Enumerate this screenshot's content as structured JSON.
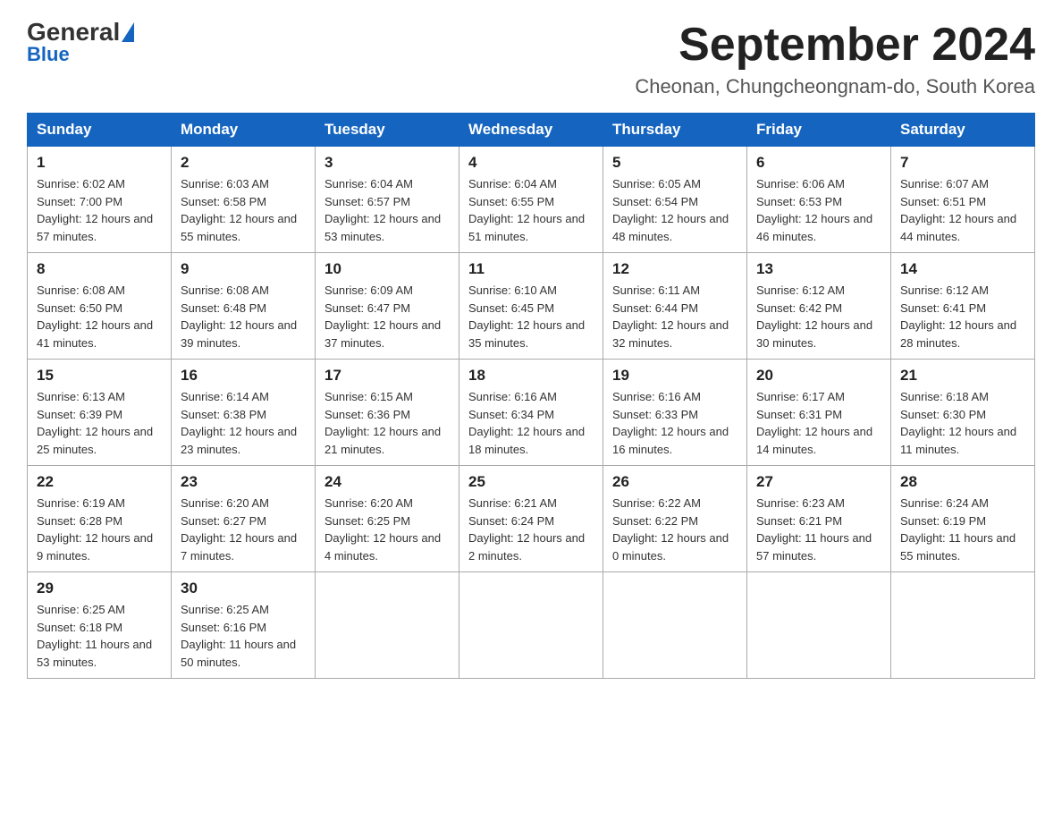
{
  "header": {
    "logo_general": "General",
    "logo_blue": "Blue",
    "month_title": "September 2024",
    "location": "Cheonan, Chungcheongnam-do, South Korea"
  },
  "weekdays": [
    "Sunday",
    "Monday",
    "Tuesday",
    "Wednesday",
    "Thursday",
    "Friday",
    "Saturday"
  ],
  "weeks": [
    [
      {
        "day": "1",
        "sunrise": "6:02 AM",
        "sunset": "7:00 PM",
        "daylight": "12 hours and 57 minutes."
      },
      {
        "day": "2",
        "sunrise": "6:03 AM",
        "sunset": "6:58 PM",
        "daylight": "12 hours and 55 minutes."
      },
      {
        "day": "3",
        "sunrise": "6:04 AM",
        "sunset": "6:57 PM",
        "daylight": "12 hours and 53 minutes."
      },
      {
        "day": "4",
        "sunrise": "6:04 AM",
        "sunset": "6:55 PM",
        "daylight": "12 hours and 51 minutes."
      },
      {
        "day": "5",
        "sunrise": "6:05 AM",
        "sunset": "6:54 PM",
        "daylight": "12 hours and 48 minutes."
      },
      {
        "day": "6",
        "sunrise": "6:06 AM",
        "sunset": "6:53 PM",
        "daylight": "12 hours and 46 minutes."
      },
      {
        "day": "7",
        "sunrise": "6:07 AM",
        "sunset": "6:51 PM",
        "daylight": "12 hours and 44 minutes."
      }
    ],
    [
      {
        "day": "8",
        "sunrise": "6:08 AM",
        "sunset": "6:50 PM",
        "daylight": "12 hours and 41 minutes."
      },
      {
        "day": "9",
        "sunrise": "6:08 AM",
        "sunset": "6:48 PM",
        "daylight": "12 hours and 39 minutes."
      },
      {
        "day": "10",
        "sunrise": "6:09 AM",
        "sunset": "6:47 PM",
        "daylight": "12 hours and 37 minutes."
      },
      {
        "day": "11",
        "sunrise": "6:10 AM",
        "sunset": "6:45 PM",
        "daylight": "12 hours and 35 minutes."
      },
      {
        "day": "12",
        "sunrise": "6:11 AM",
        "sunset": "6:44 PM",
        "daylight": "12 hours and 32 minutes."
      },
      {
        "day": "13",
        "sunrise": "6:12 AM",
        "sunset": "6:42 PM",
        "daylight": "12 hours and 30 minutes."
      },
      {
        "day": "14",
        "sunrise": "6:12 AM",
        "sunset": "6:41 PM",
        "daylight": "12 hours and 28 minutes."
      }
    ],
    [
      {
        "day": "15",
        "sunrise": "6:13 AM",
        "sunset": "6:39 PM",
        "daylight": "12 hours and 25 minutes."
      },
      {
        "day": "16",
        "sunrise": "6:14 AM",
        "sunset": "6:38 PM",
        "daylight": "12 hours and 23 minutes."
      },
      {
        "day": "17",
        "sunrise": "6:15 AM",
        "sunset": "6:36 PM",
        "daylight": "12 hours and 21 minutes."
      },
      {
        "day": "18",
        "sunrise": "6:16 AM",
        "sunset": "6:34 PM",
        "daylight": "12 hours and 18 minutes."
      },
      {
        "day": "19",
        "sunrise": "6:16 AM",
        "sunset": "6:33 PM",
        "daylight": "12 hours and 16 minutes."
      },
      {
        "day": "20",
        "sunrise": "6:17 AM",
        "sunset": "6:31 PM",
        "daylight": "12 hours and 14 minutes."
      },
      {
        "day": "21",
        "sunrise": "6:18 AM",
        "sunset": "6:30 PM",
        "daylight": "12 hours and 11 minutes."
      }
    ],
    [
      {
        "day": "22",
        "sunrise": "6:19 AM",
        "sunset": "6:28 PM",
        "daylight": "12 hours and 9 minutes."
      },
      {
        "day": "23",
        "sunrise": "6:20 AM",
        "sunset": "6:27 PM",
        "daylight": "12 hours and 7 minutes."
      },
      {
        "day": "24",
        "sunrise": "6:20 AM",
        "sunset": "6:25 PM",
        "daylight": "12 hours and 4 minutes."
      },
      {
        "day": "25",
        "sunrise": "6:21 AM",
        "sunset": "6:24 PM",
        "daylight": "12 hours and 2 minutes."
      },
      {
        "day": "26",
        "sunrise": "6:22 AM",
        "sunset": "6:22 PM",
        "daylight": "12 hours and 0 minutes."
      },
      {
        "day": "27",
        "sunrise": "6:23 AM",
        "sunset": "6:21 PM",
        "daylight": "11 hours and 57 minutes."
      },
      {
        "day": "28",
        "sunrise": "6:24 AM",
        "sunset": "6:19 PM",
        "daylight": "11 hours and 55 minutes."
      }
    ],
    [
      {
        "day": "29",
        "sunrise": "6:25 AM",
        "sunset": "6:18 PM",
        "daylight": "11 hours and 53 minutes."
      },
      {
        "day": "30",
        "sunrise": "6:25 AM",
        "sunset": "6:16 PM",
        "daylight": "11 hours and 50 minutes."
      },
      null,
      null,
      null,
      null,
      null
    ]
  ]
}
